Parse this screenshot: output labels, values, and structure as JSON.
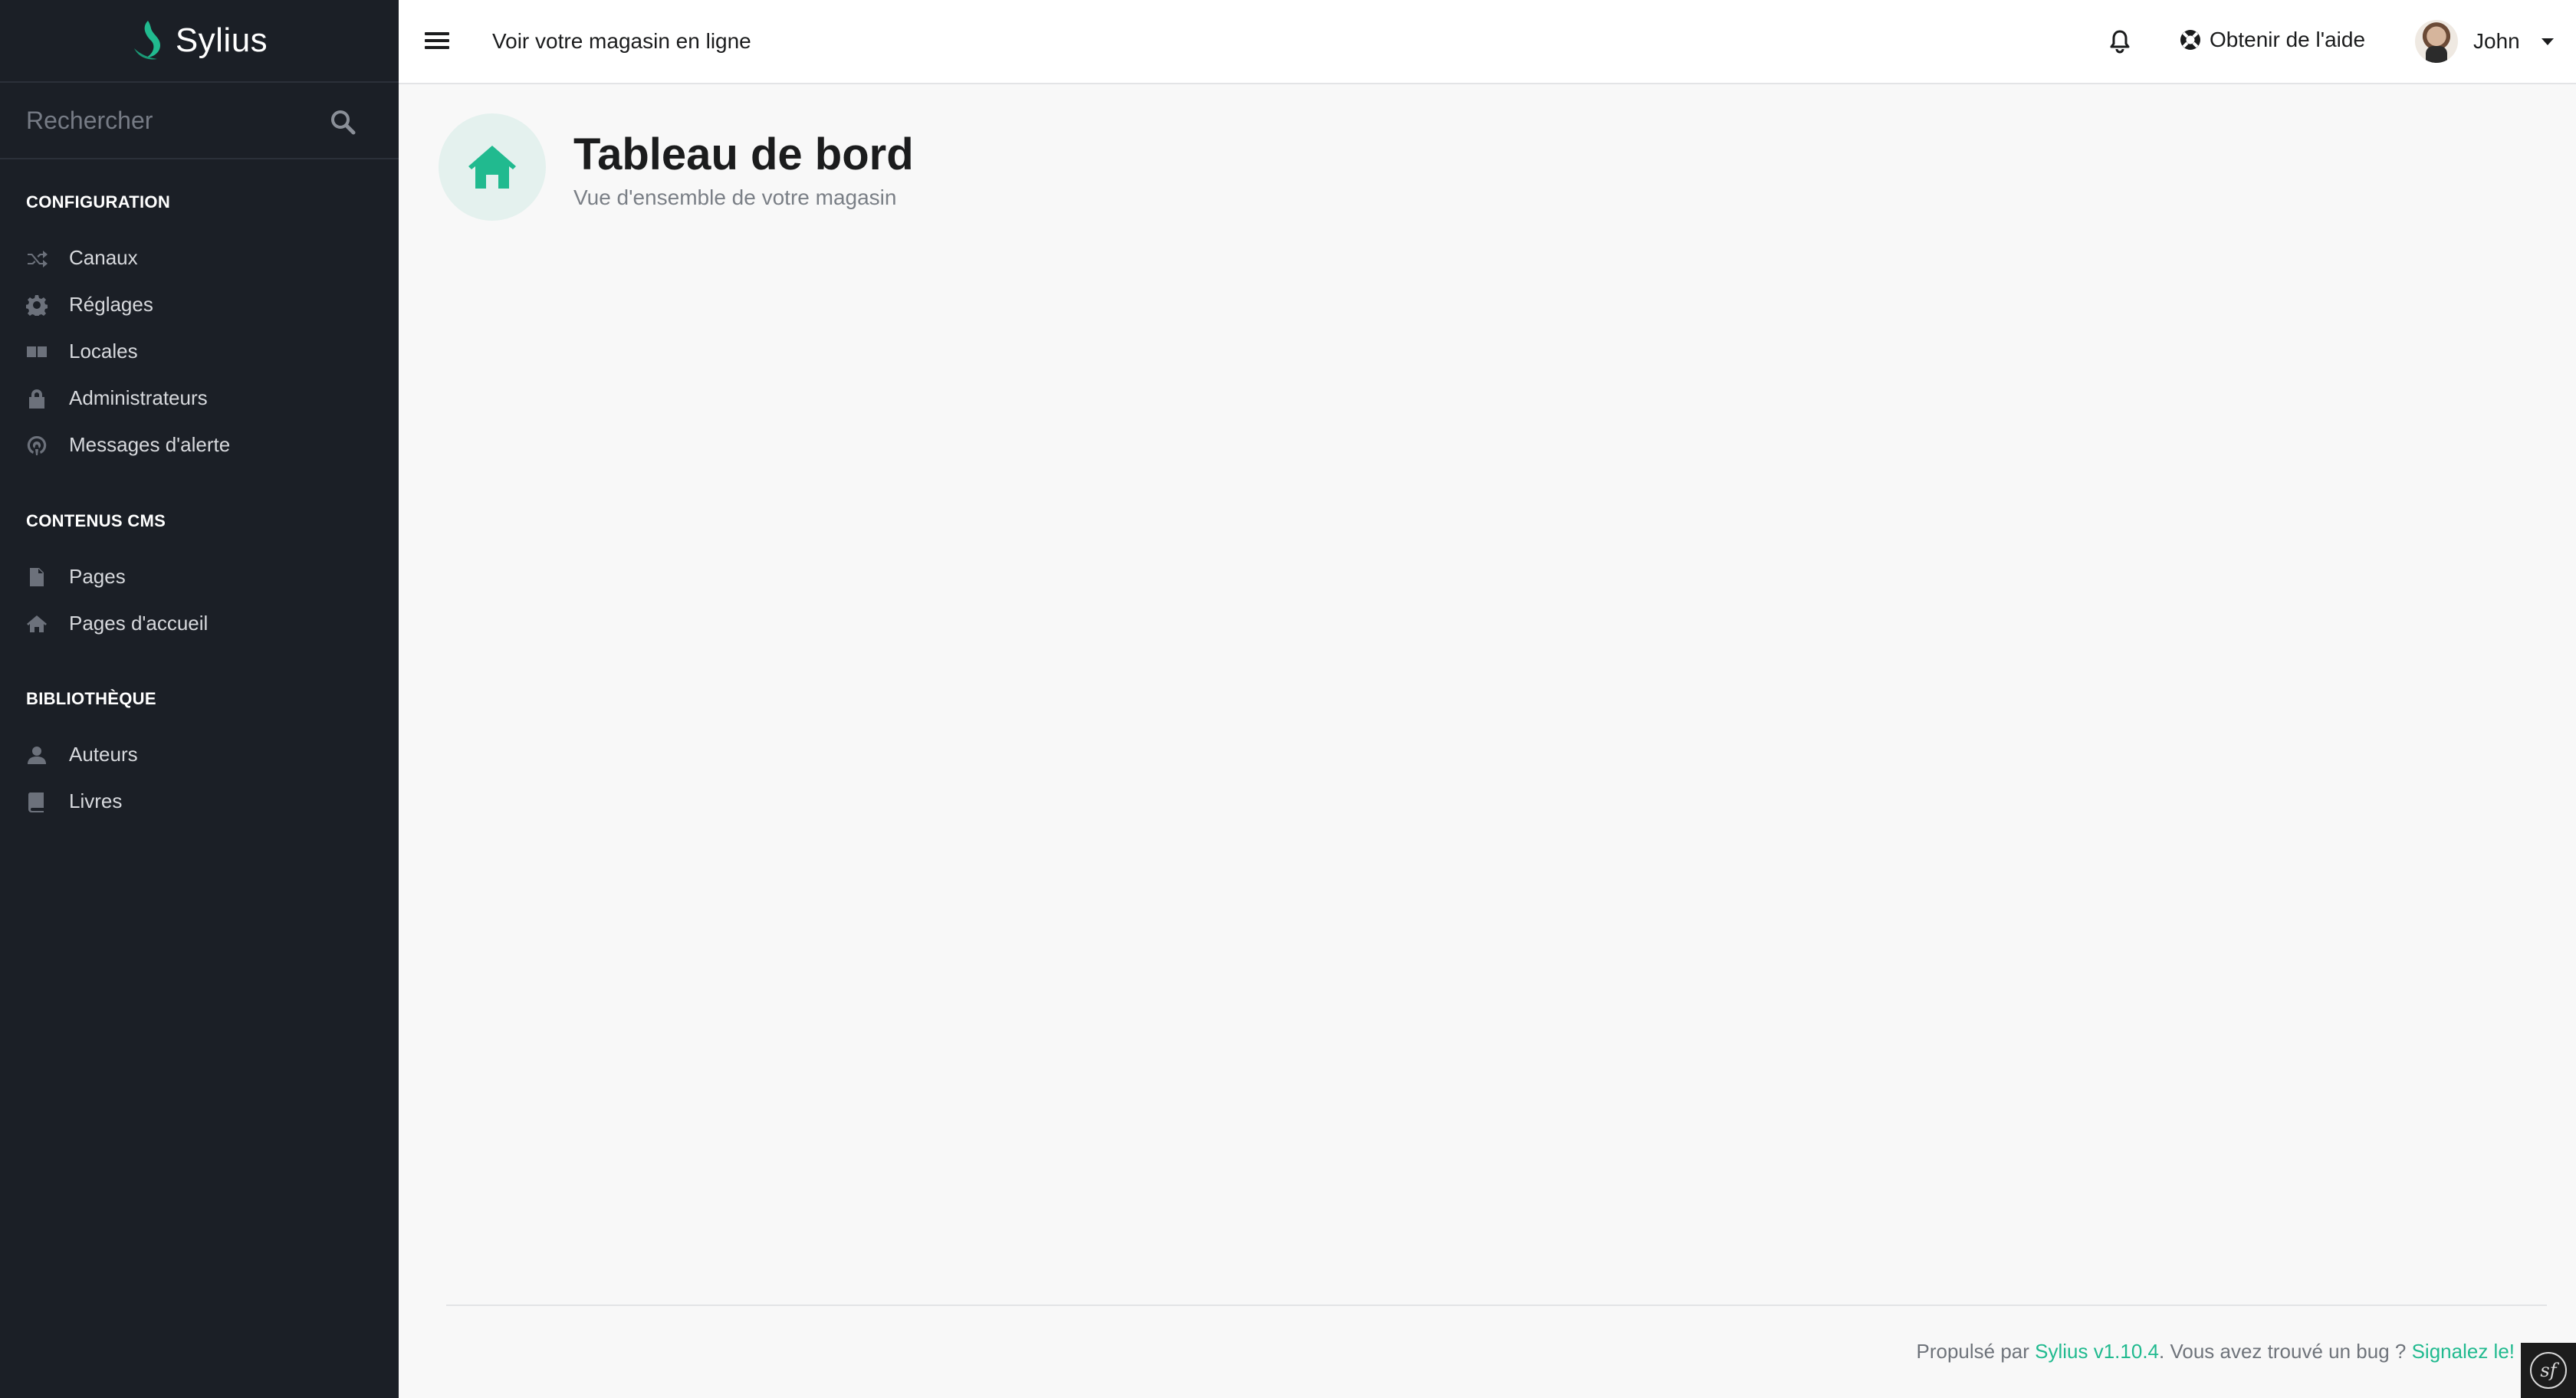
{
  "brand": {
    "name": "Sylius",
    "accent": "#21ba8f"
  },
  "search": {
    "placeholder": "Rechercher"
  },
  "sidebar": {
    "sections": [
      {
        "title": "CONFIGURATION",
        "items": [
          {
            "label": "Canaux",
            "icon": "shuffle-icon"
          },
          {
            "label": "Réglages",
            "icon": "gear-icon"
          },
          {
            "label": "Locales",
            "icon": "translate-icon"
          },
          {
            "label": "Administrateurs",
            "icon": "lock-icon"
          },
          {
            "label": "Messages d'alerte",
            "icon": "podcast-icon"
          }
        ]
      },
      {
        "title": "CONTENUS CMS",
        "items": [
          {
            "label": "Pages",
            "icon": "file-icon"
          },
          {
            "label": "Pages d'accueil",
            "icon": "home-icon"
          }
        ]
      },
      {
        "title": "BIBLIOTHÈQUE",
        "items": [
          {
            "label": "Auteurs",
            "icon": "user-icon"
          },
          {
            "label": "Livres",
            "icon": "book-icon"
          }
        ]
      }
    ]
  },
  "topbar": {
    "shop_link": "Voir votre magasin en ligne",
    "help_label": "Obtenir de l'aide",
    "user_name": "John"
  },
  "page": {
    "title": "Tableau de bord",
    "subtitle": "Vue d'ensemble de votre magasin",
    "icon": "home-icon"
  },
  "footer": {
    "powered_by": "Propulsé par ",
    "version_link": "Sylius v1.10.4",
    "bug_text": ". Vous avez trouvé un bug ? ",
    "report_link": "Signalez le!"
  }
}
